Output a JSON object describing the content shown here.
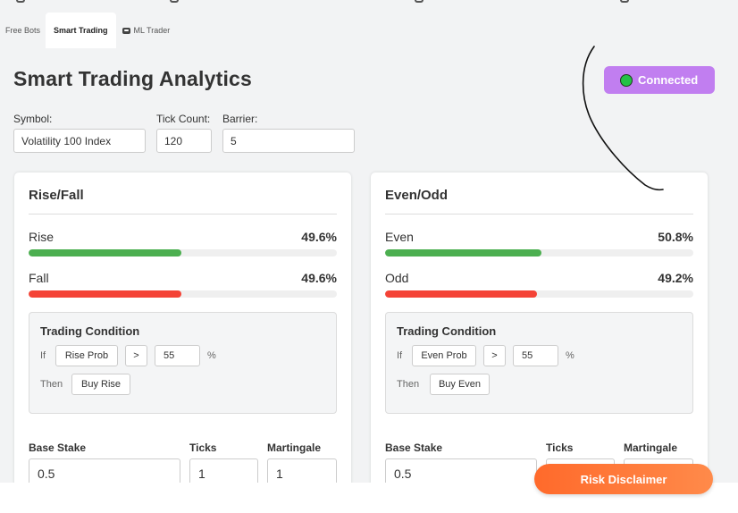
{
  "tabs": [
    {
      "label": "Free Bots"
    },
    {
      "label": "Smart Trading"
    },
    {
      "label": "ML Trader",
      "icon": "ml-trader-icon"
    }
  ],
  "title": "Smart Trading Analytics",
  "status": {
    "label": "Connected",
    "dot_color": "#23c146",
    "bg_color": "#c17ef0"
  },
  "fields": {
    "symbol": {
      "label": "Symbol:",
      "value": "Volatility 100 Index"
    },
    "tick_count": {
      "label": "Tick Count:",
      "value": "120"
    },
    "barrier": {
      "label": "Barrier:",
      "value": "5"
    }
  },
  "cards": [
    {
      "title": "Rise/Fall",
      "stats": [
        {
          "label": "Rise",
          "value": "49.6%",
          "fraction": 0.496,
          "color": "#4caf50"
        },
        {
          "label": "Fall",
          "value": "49.6%",
          "fraction": 0.496,
          "color": "#f44336"
        }
      ],
      "condition": {
        "title": "Trading Condition",
        "if_word": "If",
        "metric": "Rise Prob",
        "operator": ">",
        "threshold": "55",
        "unit": "%",
        "then_word": "Then",
        "action": "Buy Rise"
      },
      "settings": {
        "base_stake_label": "Base Stake",
        "base_stake": "0.5",
        "ticks_label": "Ticks",
        "ticks": "1",
        "martingale_label": "Martingale",
        "martingale": "1"
      }
    },
    {
      "title": "Even/Odd",
      "stats": [
        {
          "label": "Even",
          "value": "50.8%",
          "fraction": 0.508,
          "color": "#4caf50"
        },
        {
          "label": "Odd",
          "value": "49.2%",
          "fraction": 0.492,
          "color": "#f44336"
        }
      ],
      "condition": {
        "title": "Trading Condition",
        "if_word": "If",
        "metric": "Even Prob",
        "operator": ">",
        "threshold": "55",
        "unit": "%",
        "then_word": "Then",
        "action": "Buy Even"
      },
      "settings": {
        "base_stake_label": "Base Stake",
        "base_stake": "0.5",
        "ticks_label": "Ticks",
        "martingale_label": "Martingale"
      }
    }
  ],
  "risk_button": {
    "label": "Risk Disclaimer"
  }
}
